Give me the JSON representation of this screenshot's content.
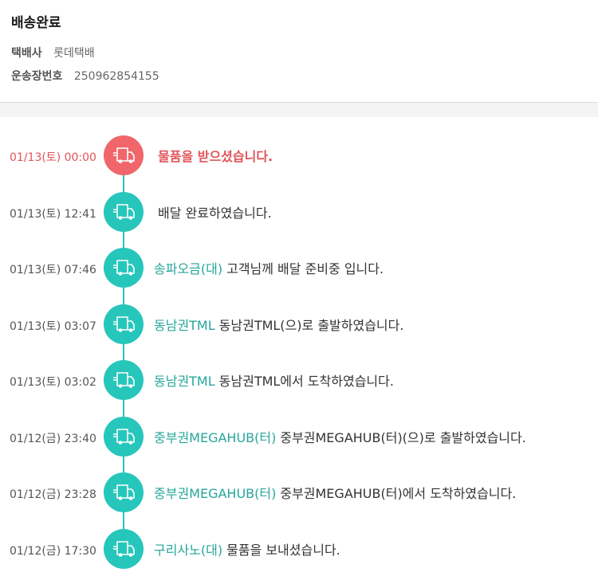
{
  "header": {
    "title": "배송완료",
    "courier_label": "택배사",
    "courier_value": "롯데택배",
    "tracking_label": "운송장번호",
    "tracking_value": "250962854155"
  },
  "colors": {
    "accent": "#26c6bb",
    "current": "#f0666b",
    "location_text": "#26a69a"
  },
  "icons": {
    "event_icon": "truck-icon"
  },
  "events": [
    {
      "time": "01/13(토) 00:00",
      "location": "",
      "message": "물품을 받으셨습니다.",
      "current": true
    },
    {
      "time": "01/13(토) 12:41",
      "location": "",
      "message": "배달 완료하였습니다."
    },
    {
      "time": "01/13(토) 07:46",
      "location": "송파오금(대)",
      "message": "고객님께 배달 준비중 입니다."
    },
    {
      "time": "01/13(토) 03:07",
      "location": "동남권TML",
      "message": "동남권TML(으)로 출발하였습니다."
    },
    {
      "time": "01/13(토) 03:02",
      "location": "동남권TML",
      "message": "동남권TML에서 도착하였습니다."
    },
    {
      "time": "01/12(금) 23:40",
      "location": "중부권MEGAHUB(터)",
      "message": "중부권MEGAHUB(터)(으)로 출발하였습니다."
    },
    {
      "time": "01/12(금) 23:28",
      "location": "중부권MEGAHUB(터)",
      "message": "중부권MEGAHUB(터)에서 도착하였습니다."
    },
    {
      "time": "01/12(금) 17:30",
      "location": "구리사노(대)",
      "message": "물품을 보내셨습니다."
    }
  ]
}
